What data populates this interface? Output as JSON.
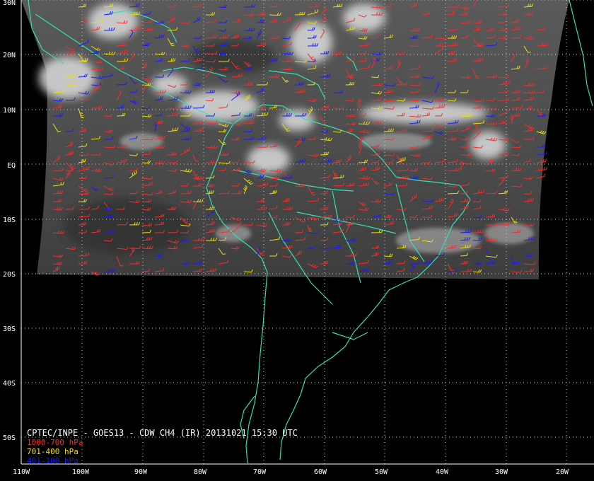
{
  "map": {
    "caption": "CPTEC/INPE - GOES13 - CDW CH4 (IR) 20131021 15:30 UTC",
    "legend": [
      {
        "label": "1000-700 hPa",
        "color": "#ff2a2a"
      },
      {
        "label": "701-400 hPa",
        "color": "#f0e000"
      },
      {
        "label": "401-100 hPa",
        "color": "#1a1aff"
      }
    ],
    "latitude_labels": [
      "30N",
      "20N",
      "10N",
      "EQ",
      "10S",
      "20S",
      "30S",
      "40S",
      "50S"
    ],
    "longitude_labels": [
      "110W",
      "100W",
      "90W",
      "80W",
      "70W",
      "60W",
      "50W",
      "40W",
      "30W",
      "20W"
    ],
    "colors": {
      "background": "#000000",
      "coastline": "#33e0b0",
      "grid": "#cfcfcf",
      "satellite_gray": "#555555"
    }
  }
}
